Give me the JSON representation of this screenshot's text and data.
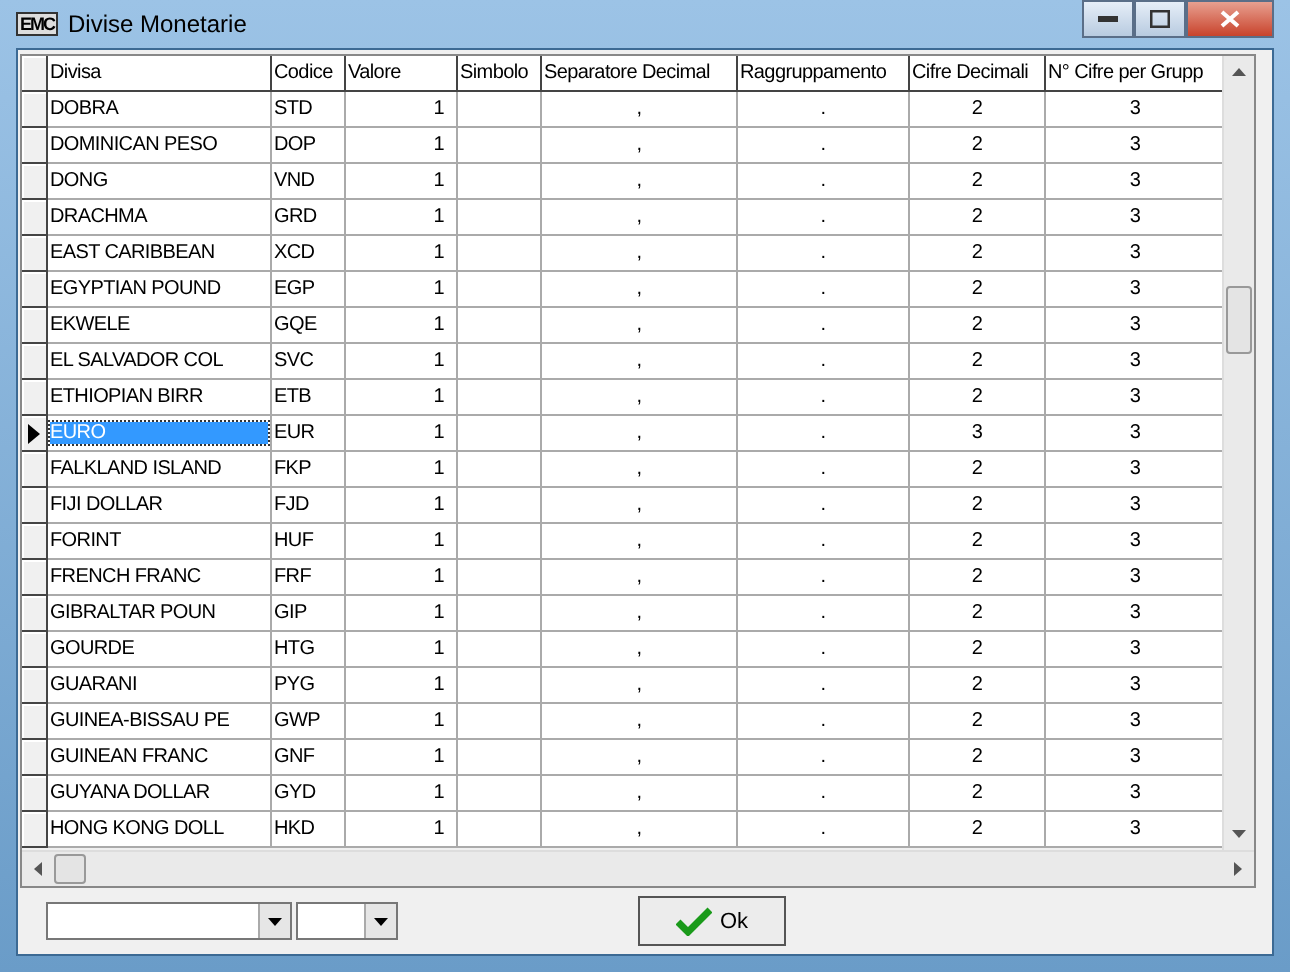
{
  "window": {
    "title": "Divise Monetarie",
    "logo": "EMC"
  },
  "grid": {
    "columns": [
      "Divisa",
      "Codice",
      "Valore",
      "Simbolo",
      "Separatore Decimal",
      "Raggruppamento",
      "Cifre Decimali",
      "N° Cifre per Grupp"
    ],
    "rows": [
      {
        "divisa": "DOBRA",
        "codice": "STD",
        "valore": "1",
        "separatore": ",",
        "raggruppamento": ".",
        "cifre_decimali": "2",
        "cifre_gruppo": "3",
        "selected": false
      },
      {
        "divisa": "DOMINICAN PESO",
        "codice": "DOP",
        "valore": "1",
        "separatore": ",",
        "raggruppamento": ".",
        "cifre_decimali": "2",
        "cifre_gruppo": "3",
        "selected": false
      },
      {
        "divisa": "DONG",
        "codice": "VND",
        "valore": "1",
        "separatore": ",",
        "raggruppamento": ".",
        "cifre_decimali": "2",
        "cifre_gruppo": "3",
        "selected": false
      },
      {
        "divisa": "DRACHMA",
        "codice": "GRD",
        "valore": "1",
        "separatore": ",",
        "raggruppamento": ".",
        "cifre_decimali": "2",
        "cifre_gruppo": "3",
        "selected": false
      },
      {
        "divisa": "EAST CARIBBEAN",
        "codice": "XCD",
        "valore": "1",
        "separatore": ",",
        "raggruppamento": ".",
        "cifre_decimali": "2",
        "cifre_gruppo": "3",
        "selected": false
      },
      {
        "divisa": "EGYPTIAN POUND",
        "codice": "EGP",
        "valore": "1",
        "separatore": ",",
        "raggruppamento": ".",
        "cifre_decimali": "2",
        "cifre_gruppo": "3",
        "selected": false
      },
      {
        "divisa": "EKWELE",
        "codice": "GQE",
        "valore": "1",
        "separatore": ",",
        "raggruppamento": ".",
        "cifre_decimali": "2",
        "cifre_gruppo": "3",
        "selected": false
      },
      {
        "divisa": "EL SALVADOR COL",
        "codice": "SVC",
        "valore": "1",
        "separatore": ",",
        "raggruppamento": ".",
        "cifre_decimali": "2",
        "cifre_gruppo": "3",
        "selected": false
      },
      {
        "divisa": "ETHIOPIAN BIRR",
        "codice": "ETB",
        "valore": "1",
        "separatore": ",",
        "raggruppamento": ".",
        "cifre_decimali": "2",
        "cifre_gruppo": "3",
        "selected": false
      },
      {
        "divisa": "EURO",
        "codice": "EUR",
        "valore": "1",
        "separatore": ",",
        "raggruppamento": ".",
        "cifre_decimali": "3",
        "cifre_gruppo": "3",
        "selected": true
      },
      {
        "divisa": "FALKLAND ISLAND",
        "codice": "FKP",
        "valore": "1",
        "separatore": ",",
        "raggruppamento": ".",
        "cifre_decimali": "2",
        "cifre_gruppo": "3",
        "selected": false
      },
      {
        "divisa": "FIJI DOLLAR",
        "codice": "FJD",
        "valore": "1",
        "separatore": ",",
        "raggruppamento": ".",
        "cifre_decimali": "2",
        "cifre_gruppo": "3",
        "selected": false
      },
      {
        "divisa": "FORINT",
        "codice": "HUF",
        "valore": "1",
        "separatore": ",",
        "raggruppamento": ".",
        "cifre_decimali": "2",
        "cifre_gruppo": "3",
        "selected": false
      },
      {
        "divisa": "FRENCH FRANC",
        "codice": "FRF",
        "valore": "1",
        "separatore": ",",
        "raggruppamento": ".",
        "cifre_decimali": "2",
        "cifre_gruppo": "3",
        "selected": false
      },
      {
        "divisa": "GIBRALTAR POUN",
        "codice": "GIP",
        "valore": "1",
        "separatore": ",",
        "raggruppamento": ".",
        "cifre_decimali": "2",
        "cifre_gruppo": "3",
        "selected": false
      },
      {
        "divisa": "GOURDE",
        "codice": "HTG",
        "valore": "1",
        "separatore": ",",
        "raggruppamento": ".",
        "cifre_decimali": "2",
        "cifre_gruppo": "3",
        "selected": false
      },
      {
        "divisa": "GUARANI",
        "codice": "PYG",
        "valore": "1",
        "separatore": ",",
        "raggruppamento": ".",
        "cifre_decimali": "2",
        "cifre_gruppo": "3",
        "selected": false
      },
      {
        "divisa": "GUINEA-BISSAU PE",
        "codice": "GWP",
        "valore": "1",
        "separatore": ",",
        "raggruppamento": ".",
        "cifre_decimali": "2",
        "cifre_gruppo": "3",
        "selected": false
      },
      {
        "divisa": "GUINEAN FRANC",
        "codice": "GNF",
        "valore": "1",
        "separatore": ",",
        "raggruppamento": ".",
        "cifre_decimali": "2",
        "cifre_gruppo": "3",
        "selected": false
      },
      {
        "divisa": "GUYANA DOLLAR",
        "codice": "GYD",
        "valore": "1",
        "separatore": ",",
        "raggruppamento": ".",
        "cifre_decimali": "2",
        "cifre_gruppo": "3",
        "selected": false
      },
      {
        "divisa": "HONG KONG DOLL",
        "codice": "HKD",
        "valore": "1",
        "separatore": ",",
        "raggruppamento": ".",
        "cifre_decimali": "2",
        "cifre_gruppo": "3",
        "selected": false
      }
    ]
  },
  "ok_button": "Ok"
}
